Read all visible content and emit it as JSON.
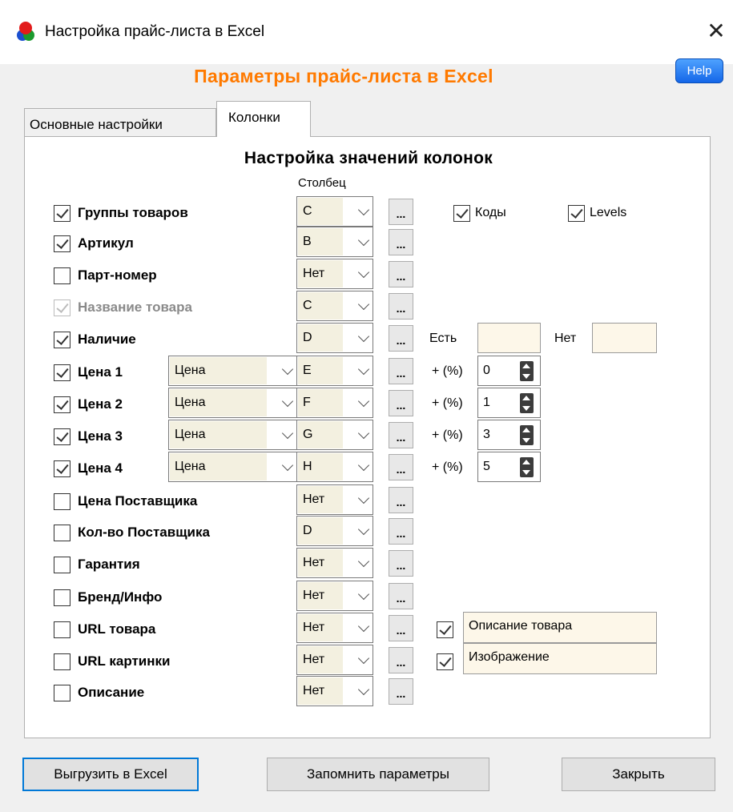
{
  "window": {
    "title": "Настройка прайс-листа в Excel",
    "heading": "Параметры прайс-листа в Excel",
    "help_label": "Help",
    "close_glyph": "✕"
  },
  "tabs": [
    {
      "label": "Основные настройки",
      "active": false
    },
    {
      "label": "Колонки",
      "active": true
    }
  ],
  "section": {
    "title": "Настройка значений колонок",
    "column_header": "Столбец"
  },
  "dots_label": "...",
  "rows": [
    {
      "label": "Группы товаров",
      "checked": true,
      "column": "C"
    },
    {
      "label": "Артикул",
      "checked": true,
      "column": "B"
    },
    {
      "label": "Парт-номер",
      "checked": false,
      "column": "Нет"
    },
    {
      "label": "Название товара",
      "checked": true,
      "disabled": true,
      "column": "C"
    },
    {
      "label": "Наличие",
      "checked": true,
      "column": "D"
    },
    {
      "label": "Цена 1",
      "checked": true,
      "price_type": "Цена",
      "column": "E",
      "percent": "0"
    },
    {
      "label": "Цена 2",
      "checked": true,
      "price_type": "Цена",
      "column": "F",
      "percent": "1"
    },
    {
      "label": "Цена 3",
      "checked": true,
      "price_type": "Цена",
      "column": "G",
      "percent": "3"
    },
    {
      "label": "Цена 4",
      "checked": true,
      "price_type": "Цена",
      "column": "H",
      "percent": "5"
    },
    {
      "label": "Цена Поставщика",
      "checked": false,
      "column": "Нет"
    },
    {
      "label": "Кол-во Поставщика",
      "checked": false,
      "column": "D"
    },
    {
      "label": "Гарантия",
      "checked": false,
      "column": "Нет"
    },
    {
      "label": "Бренд/Инфо",
      "checked": false,
      "column": "Нет"
    },
    {
      "label": "URL товара",
      "checked": false,
      "column": "Нет"
    },
    {
      "label": "URL картинки",
      "checked": false,
      "column": "Нет"
    },
    {
      "label": "Описание",
      "checked": false,
      "column": "Нет"
    }
  ],
  "groups_extra": {
    "codes_label": "Коды",
    "codes_checked": true,
    "levels_label": "Levels",
    "levels_checked": true
  },
  "availability": {
    "yes_label": "Есть",
    "yes_value": "",
    "no_label": "Нет",
    "no_value": ""
  },
  "percent_label": "+ (%)",
  "url_extra": [
    {
      "checked": true,
      "value": "Описание товара"
    },
    {
      "checked": true,
      "value": "Изображение"
    }
  ],
  "footer": {
    "export_label": "Выгрузить в Excel",
    "save_label": "Запомнить параметры",
    "close_label": "Закрыть"
  }
}
